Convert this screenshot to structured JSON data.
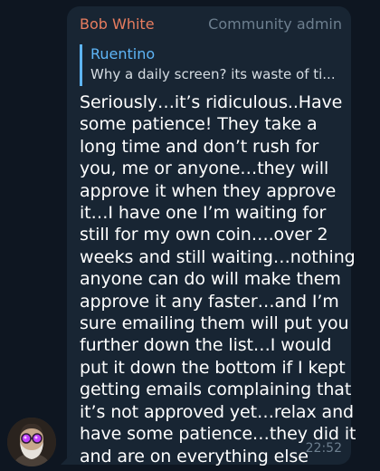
{
  "sender": {
    "name": "Bob White",
    "role": "Community admin"
  },
  "reply": {
    "author": "Ruentino",
    "text": "Why a daily screen? its waste of ti..."
  },
  "message": {
    "lines": [
      "Seriously…it’s ridiculous..Have",
      "some patience! They take a",
      "long time and don’t rush for",
      "you, me or anyone…they will",
      "approve it when they approve",
      "it…I have one I’m waiting for",
      "still for my own coin….over 2",
      "weeks and still waiting…nothing",
      "anyone can do will make them",
      "approve it any faster…and I’m",
      "sure emailing them will put you",
      "further down the list…I would",
      "put it down the bottom if I kept",
      "getting emails complaining that",
      "it’s not approved yet…relax and",
      "have some patience…they did it",
      "and are on everything else"
    ],
    "time": "22:52"
  },
  "colors": {
    "background": "#0e1621",
    "bubble": "#182533",
    "sender_name": "#e87d5f",
    "reply_accent": "#5eb5f7",
    "meta_text": "#6d7f8f"
  },
  "icons": {
    "avatar": "user-avatar-bearded-man-purple-glasses"
  }
}
